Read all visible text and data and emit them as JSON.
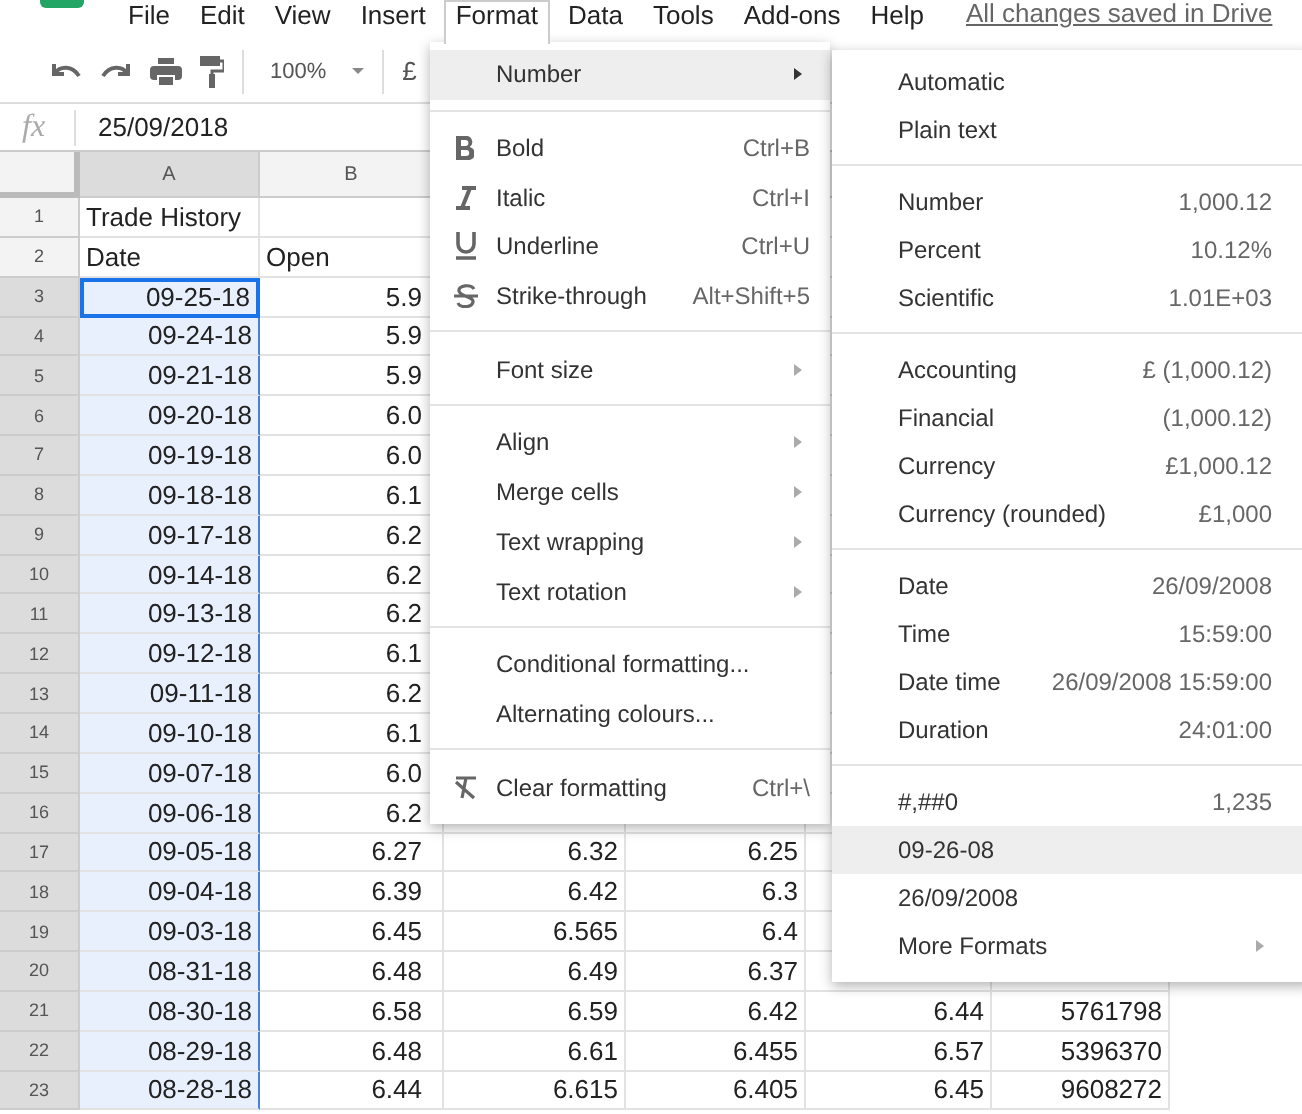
{
  "menu_bar": {
    "items": [
      {
        "label": "File",
        "selected": false
      },
      {
        "label": "Edit",
        "selected": false
      },
      {
        "label": "View",
        "selected": false
      },
      {
        "label": "Insert",
        "selected": false
      },
      {
        "label": "Format",
        "selected": true
      },
      {
        "label": "Data",
        "selected": false
      },
      {
        "label": "Tools",
        "selected": false
      },
      {
        "label": "Add-ons",
        "selected": false
      },
      {
        "label": "Help",
        "selected": false
      }
    ],
    "save_status": "All changes saved in Drive"
  },
  "toolbar": {
    "zoom": "100%",
    "currency": "£"
  },
  "formula_bar": {
    "label": "fx",
    "value": "25/09/2018"
  },
  "columns": [
    {
      "label": "A",
      "selected": true
    },
    {
      "label": "B",
      "selected": false
    }
  ],
  "rows": [
    {
      "number": "1",
      "kind": "text",
      "selected": false,
      "active": false,
      "cells": [
        "Trade History"
      ]
    },
    {
      "number": "2",
      "kind": "text",
      "selected": false,
      "active": false,
      "cells": [
        "Date",
        "Open"
      ]
    },
    {
      "number": "3",
      "kind": "value",
      "selected": true,
      "active": true,
      "cells": [
        "09-25-18",
        "5.9"
      ]
    },
    {
      "number": "4",
      "kind": "value",
      "selected": true,
      "active": false,
      "cells": [
        "09-24-18",
        "5.9"
      ]
    },
    {
      "number": "5",
      "kind": "value",
      "selected": true,
      "active": false,
      "cells": [
        "09-21-18",
        "5.9"
      ]
    },
    {
      "number": "6",
      "kind": "value",
      "selected": true,
      "active": false,
      "cells": [
        "09-20-18",
        "6.0"
      ]
    },
    {
      "number": "7",
      "kind": "value",
      "selected": true,
      "active": false,
      "cells": [
        "09-19-18",
        "6.0"
      ]
    },
    {
      "number": "8",
      "kind": "value",
      "selected": true,
      "active": false,
      "cells": [
        "09-18-18",
        "6.1"
      ]
    },
    {
      "number": "9",
      "kind": "value",
      "selected": true,
      "active": false,
      "cells": [
        "09-17-18",
        "6.2"
      ]
    },
    {
      "number": "10",
      "kind": "value",
      "selected": true,
      "active": false,
      "cells": [
        "09-14-18",
        "6.2"
      ]
    },
    {
      "number": "11",
      "kind": "value",
      "selected": true,
      "active": false,
      "cells": [
        "09-13-18",
        "6.2"
      ]
    },
    {
      "number": "12",
      "kind": "value",
      "selected": true,
      "active": false,
      "cells": [
        "09-12-18",
        "6.1"
      ]
    },
    {
      "number": "13",
      "kind": "value",
      "selected": true,
      "active": false,
      "cells": [
        "09-11-18",
        "6.2"
      ]
    },
    {
      "number": "14",
      "kind": "value",
      "selected": true,
      "active": false,
      "cells": [
        "09-10-18",
        "6.1"
      ]
    },
    {
      "number": "15",
      "kind": "value",
      "selected": true,
      "active": false,
      "cells": [
        "09-07-18",
        "6.0"
      ]
    },
    {
      "number": "16",
      "kind": "value",
      "selected": true,
      "active": false,
      "cells": [
        "09-06-18",
        "6.2"
      ]
    },
    {
      "number": "17",
      "kind": "value",
      "selected": true,
      "active": false,
      "cells": [
        "09-05-18",
        "6.27",
        "6.32",
        "6.25"
      ]
    },
    {
      "number": "18",
      "kind": "value",
      "selected": true,
      "active": false,
      "cells": [
        "09-04-18",
        "6.39",
        "6.42",
        "6.3"
      ]
    },
    {
      "number": "19",
      "kind": "value",
      "selected": true,
      "active": false,
      "cells": [
        "09-03-18",
        "6.45",
        "6.565",
        "6.4"
      ]
    },
    {
      "number": "20",
      "kind": "value",
      "selected": true,
      "active": false,
      "cells": [
        "08-31-18",
        "6.48",
        "6.49",
        "6.37"
      ]
    },
    {
      "number": "21",
      "kind": "value",
      "selected": true,
      "active": false,
      "cells": [
        "08-30-18",
        "6.58",
        "6.59",
        "6.42",
        "6.44",
        "5761798"
      ]
    },
    {
      "number": "22",
      "kind": "value",
      "selected": true,
      "active": false,
      "cells": [
        "08-29-18",
        "6.48",
        "6.61",
        "6.455",
        "6.57",
        "5396370"
      ]
    },
    {
      "number": "23",
      "kind": "value",
      "selected": true,
      "active": false,
      "cells": [
        "08-28-18",
        "6.44",
        "6.615",
        "6.405",
        "6.45",
        "9608272"
      ]
    }
  ],
  "format_menu": {
    "groups": [
      {
        "items": [
          {
            "label": "Number",
            "kind": "submenu",
            "highlighted": true
          }
        ]
      },
      {
        "items": [
          {
            "label": "Bold",
            "kind": "bold",
            "shortcut": "Ctrl+B",
            "highlighted": false
          },
          {
            "label": "Italic",
            "kind": "italic",
            "shortcut": "Ctrl+I",
            "highlighted": false
          },
          {
            "label": "Underline",
            "kind": "underline",
            "shortcut": "Ctrl+U",
            "highlighted": false
          },
          {
            "label": "Strike-through",
            "kind": "strikethrough",
            "shortcut": "Alt+Shift+5",
            "highlighted": false
          }
        ]
      },
      {
        "items": [
          {
            "label": "Font size",
            "kind": "submenu",
            "highlighted": false
          }
        ]
      },
      {
        "items": [
          {
            "label": "Align",
            "kind": "submenu",
            "highlighted": false
          },
          {
            "label": "Merge cells",
            "kind": "submenu",
            "highlighted": false
          },
          {
            "label": "Text wrapping",
            "kind": "submenu",
            "highlighted": false
          },
          {
            "label": "Text rotation",
            "kind": "submenu",
            "highlighted": false
          }
        ]
      },
      {
        "items": [
          {
            "label": "Conditional formatting...",
            "kind": "plain",
            "highlighted": false
          },
          {
            "label": "Alternating colours...",
            "kind": "plain",
            "highlighted": false
          }
        ]
      },
      {
        "items": [
          {
            "label": "Clear formatting",
            "kind": "clear",
            "shortcut": "Ctrl+\\",
            "highlighted": false
          }
        ]
      }
    ]
  },
  "number_submenu": {
    "groups": [
      {
        "items": [
          {
            "label": "Automatic",
            "kind": "plain",
            "highlighted": false
          },
          {
            "label": "Plain text",
            "kind": "plain",
            "highlighted": false
          }
        ]
      },
      {
        "items": [
          {
            "label": "Number",
            "kind": "plain",
            "example": "1,000.12",
            "highlighted": false
          },
          {
            "label": "Percent",
            "kind": "plain",
            "example": "10.12%",
            "highlighted": false
          },
          {
            "label": "Scientific",
            "kind": "plain",
            "example": "1.01E+03",
            "highlighted": false
          }
        ]
      },
      {
        "items": [
          {
            "label": "Accounting",
            "kind": "plain",
            "example": "£ (1,000.12)",
            "highlighted": false
          },
          {
            "label": "Financial",
            "kind": "plain",
            "example": "(1,000.12)",
            "highlighted": false
          },
          {
            "label": "Currency",
            "kind": "plain",
            "example": "£1,000.12",
            "highlighted": false
          },
          {
            "label": "Currency (rounded)",
            "kind": "plain",
            "example": "£1,000",
            "highlighted": false
          }
        ]
      },
      {
        "items": [
          {
            "label": "Date",
            "kind": "plain",
            "example": "26/09/2008",
            "highlighted": false
          },
          {
            "label": "Time",
            "kind": "plain",
            "example": "15:59:00",
            "highlighted": false
          },
          {
            "label": "Date time",
            "kind": "plain",
            "example": "26/09/2008 15:59:00",
            "highlighted": false
          },
          {
            "label": "Duration",
            "kind": "plain",
            "example": "24:01:00",
            "highlighted": false
          }
        ]
      },
      {
        "items": [
          {
            "label": "#,##0",
            "kind": "plain",
            "example": "1,235",
            "highlighted": false
          },
          {
            "label": "09-26-08",
            "kind": "plain",
            "highlighted": true
          },
          {
            "label": "26/09/2008",
            "kind": "plain",
            "highlighted": false
          },
          {
            "label": "More Formats",
            "kind": "submenu",
            "highlighted": false
          }
        ]
      }
    ]
  }
}
